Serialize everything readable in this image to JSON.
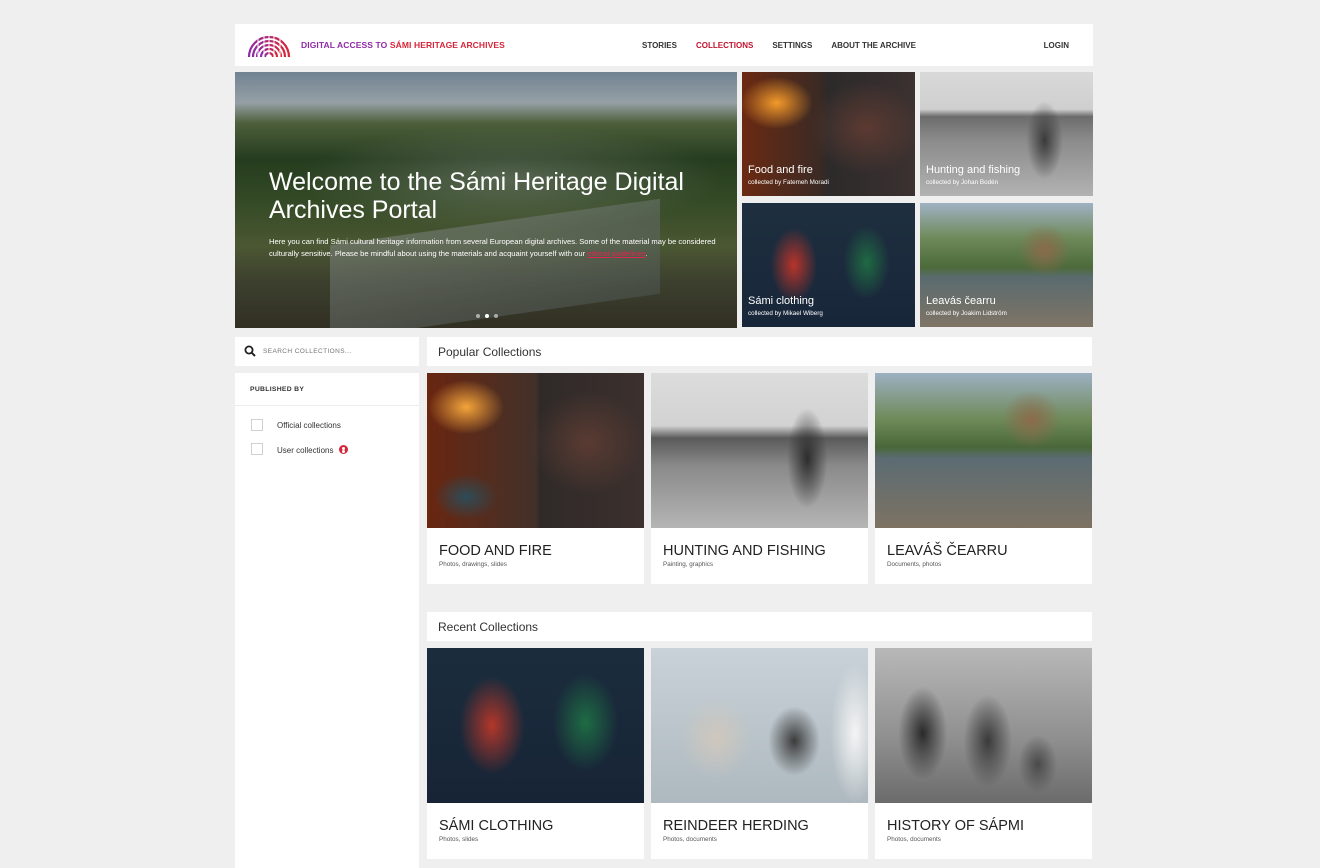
{
  "header": {
    "brand_part1": "DIGITAL ACCESS TO ",
    "brand_part2": "SÁMI HERITAGE ARCHIVES",
    "nav": [
      {
        "label": "STORIES",
        "active": false
      },
      {
        "label": "COLLECTIONS",
        "active": true
      },
      {
        "label": "SETTINGS",
        "active": false
      },
      {
        "label": "ABOUT THE ARCHIVE",
        "active": false
      }
    ],
    "login": "LOGIN"
  },
  "hero": {
    "title": "Welcome to the Sámi Heritage Digital Archives Portal",
    "text_before_link": "Here you can find Sámi cultural heritage information from several European digital archives. Some of the material may be considered culturally sensitive. Please be mindful about using the materials and acquaint yourself with our ",
    "link": "ethical guidelines",
    "text_after_link": "."
  },
  "hero_tiles": [
    {
      "title": "Food and fire",
      "subtitle": "collected by Fatemeh Moradi"
    },
    {
      "title": "Hunting and fishing",
      "subtitle": "collected by Johan Bodén"
    },
    {
      "title": "Sámi clothing",
      "subtitle": "collected by Mikael Wiberg"
    },
    {
      "title": "Leavás čearru",
      "subtitle": "collected by Joakim Lidström"
    }
  ],
  "search": {
    "placeholder": "SEARCH COLLECTIONS..."
  },
  "filters": {
    "heading": "PUBLISHED BY",
    "options": [
      {
        "label": "Official collections",
        "checked": false
      },
      {
        "label": "User collections",
        "checked": false
      }
    ]
  },
  "popular": {
    "heading": "Popular Collections",
    "cards": [
      {
        "title": "FOOD AND FIRE",
        "subtitle": "Photos, drawings, slides"
      },
      {
        "title": "HUNTING AND FISHING",
        "subtitle": "Painting, graphics"
      },
      {
        "title": "LEAVÁŠ ČEARRU",
        "subtitle": "Documents, photos"
      }
    ]
  },
  "recent": {
    "heading": "Recent Collections",
    "cards": [
      {
        "title": "SÁMI CLOTHING",
        "subtitle": "Photos, slides"
      },
      {
        "title": "REINDEER HERDING",
        "subtitle": "Photos, documents"
      },
      {
        "title": "HISTORY OF SÁPMI",
        "subtitle": "Photos, documents"
      }
    ]
  },
  "colors": {
    "brand_purple": "#8e2aa5",
    "brand_red": "#d6263a",
    "nav_active": "#c0142e",
    "page_bg": "#efefef"
  }
}
